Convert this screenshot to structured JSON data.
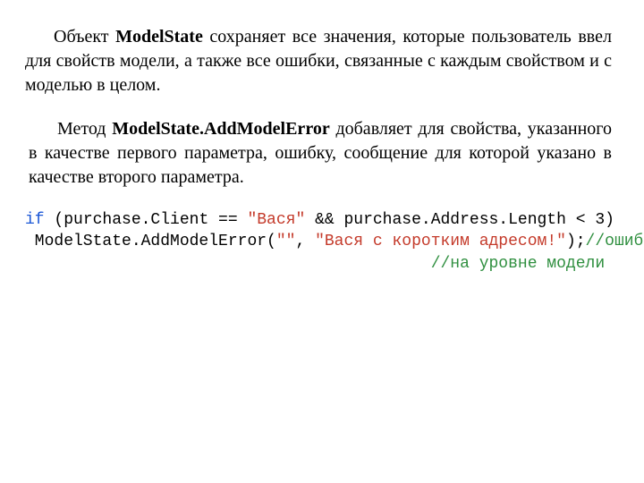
{
  "para1": {
    "pre": "Объект ",
    "bold": "ModelState",
    "post": " сохраняет все значения, которые пользователь ввел для свойств модели, а также все ошибки, связанные с каждым свойством и с моделью в целом."
  },
  "para2": {
    "pre": "Метод ",
    "bold": "ModelState.AddModelError",
    "post": " добавляет для свойства, указанного в качестве первого параметра, ошибку, сообщение для которой указано в качестве второго параметра."
  },
  "code": {
    "line1": {
      "kw": "if",
      "seg1": " (purchase.Client == ",
      "str1": "\"Вася\"",
      "seg2": " && purchase.Address.Length < 3)"
    },
    "line2": {
      "seg1": " ModelState.AddModelError(",
      "str1": "\"\"",
      "seg2": ", ",
      "str2": "\"Вася с коротким адресом!\"",
      "seg3": ");",
      "cmt1": "//ошибки"
    },
    "line3": {
      "pad": "                                          ",
      "cmt": "//на уровне модели"
    }
  }
}
